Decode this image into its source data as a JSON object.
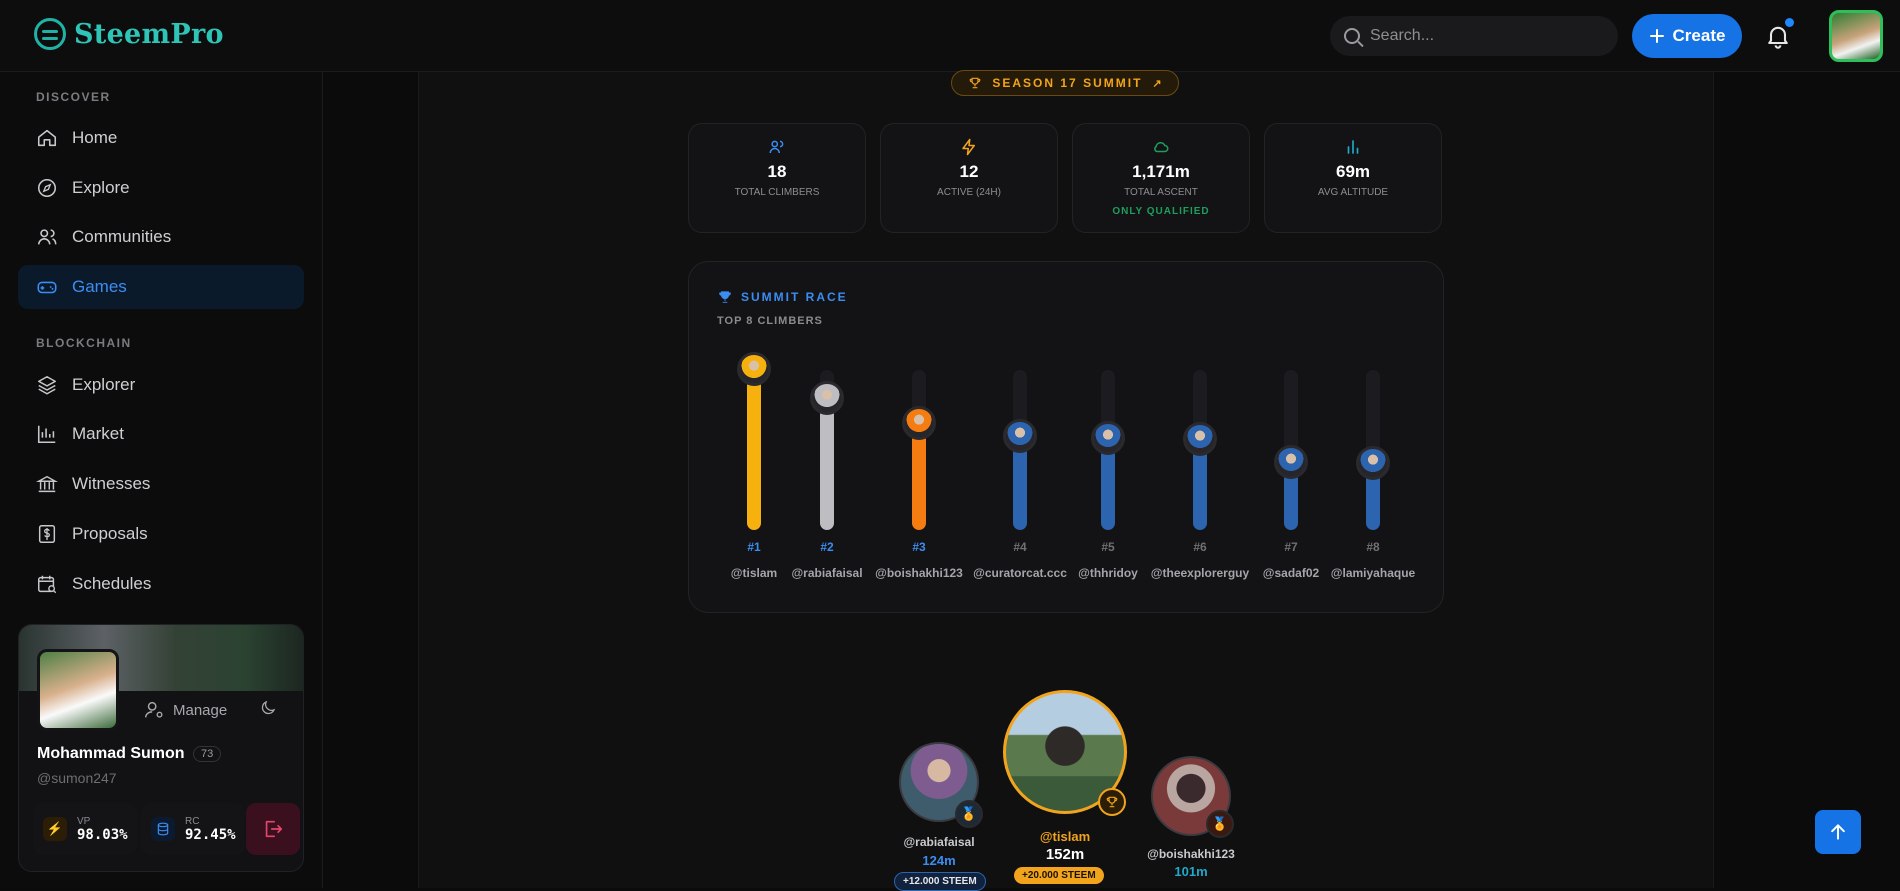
{
  "app": {
    "brand": "SteemPro",
    "accent": "#1673e6",
    "brand_color": "#2ec4b6"
  },
  "topbar": {
    "search_placeholder": "Search...",
    "create_label": "Create",
    "notification_icon": "bell-icon"
  },
  "sidebar": {
    "discover_label": "DISCOVER",
    "blockchain_label": "BLOCKCHAIN",
    "discover_items": [
      {
        "label": "Home",
        "icon": "home-icon"
      },
      {
        "label": "Explore",
        "icon": "compass-icon"
      },
      {
        "label": "Communities",
        "icon": "users-icon"
      },
      {
        "label": "Games",
        "icon": "gamepad-icon",
        "active": true
      }
    ],
    "blockchain_items": [
      {
        "label": "Explorer",
        "icon": "layers-icon"
      },
      {
        "label": "Market",
        "icon": "chart-icon"
      },
      {
        "label": "Witnesses",
        "icon": "bank-icon"
      },
      {
        "label": "Proposals",
        "icon": "dollar-doc-icon"
      },
      {
        "label": "Schedules",
        "icon": "calendar-search-icon"
      }
    ]
  },
  "profile": {
    "name": "Mohammad Sumon",
    "reputation": "73",
    "handle": "@sumon247",
    "manage_label": "Manage",
    "vp_label": "VP",
    "vp_value": "98.03%",
    "rc_label": "RC",
    "rc_value": "92.45%"
  },
  "season": {
    "label": "SEASON 17 SUMMIT"
  },
  "kpis": [
    {
      "value": "18",
      "label": "TOTAL CLIMBERS",
      "icon": "users-icon",
      "color": "#3b8df2"
    },
    {
      "value": "12",
      "label": "ACTIVE (24H)",
      "icon": "bolt-icon",
      "color": "#f2a41c"
    },
    {
      "value": "1,171m",
      "label": "TOTAL ASCENT",
      "note": "ONLY QUALIFIED",
      "icon": "cloud-icon",
      "color": "#1d9e5c"
    },
    {
      "value": "69m",
      "label": "AVG ALTITUDE",
      "icon": "bars-icon",
      "color": "#22a8c9"
    }
  ],
  "race": {
    "title": "SUMMIT RACE",
    "subtitle": "TOP 8 CLIMBERS",
    "climbers": [
      {
        "rank": "#1",
        "handle": "@tislam",
        "progress": 1.0,
        "color": "#f7b10f"
      },
      {
        "rank": "#2",
        "handle": "@rabiafaisal",
        "progress": 0.82,
        "color": "#bdbdc2"
      },
      {
        "rank": "#3",
        "handle": "@boishakhi123",
        "progress": 0.66,
        "color": "#f57c10"
      },
      {
        "rank": "#4",
        "handle": "@curatorcat.ccc",
        "progress": 0.58,
        "color": "#2d64b0"
      },
      {
        "rank": "#5",
        "handle": "@thhridoy",
        "progress": 0.57,
        "color": "#2d64b0"
      },
      {
        "rank": "#6",
        "handle": "@theexplorerguy",
        "progress": 0.56,
        "color": "#2d64b0"
      },
      {
        "rank": "#7",
        "handle": "@sadaf02",
        "progress": 0.42,
        "color": "#2d64b0"
      },
      {
        "rank": "#8",
        "handle": "@lamiyahaque",
        "progress": 0.41,
        "color": "#2d64b0"
      }
    ]
  },
  "podium": {
    "first": {
      "handle": "@tislam",
      "altitude": "152m",
      "reward": "+20.000 STEEM"
    },
    "second": {
      "handle": "@rabiafaisal",
      "altitude": "124m",
      "reward": "+12.000 STEEM"
    },
    "third": {
      "handle": "@boishakhi123",
      "altitude": "101m"
    }
  }
}
